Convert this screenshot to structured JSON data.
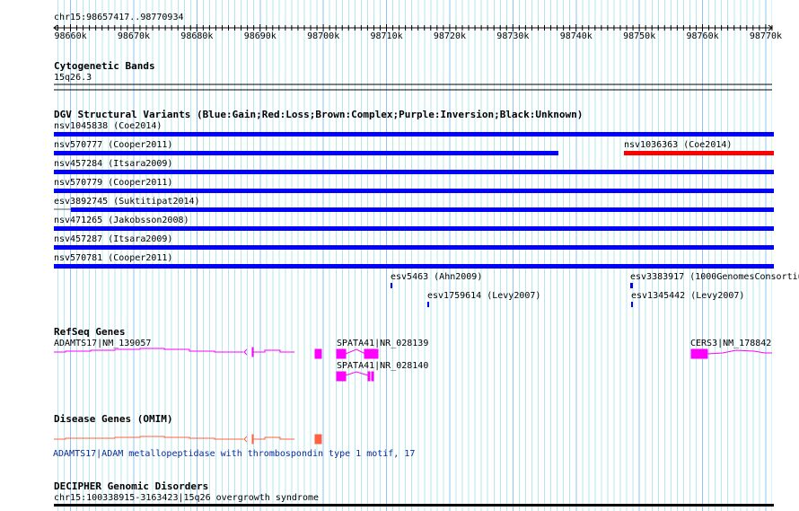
{
  "ruler": {
    "position": "chr15:98657417..98770934",
    "ticks": [
      "98660k",
      "98670k",
      "98680k",
      "98690k",
      "98700k",
      "98710k",
      "98720k",
      "98730k",
      "98740k",
      "98750k",
      "98760k",
      "98770k"
    ]
  },
  "cytoband": {
    "title": "Cytogenetic Bands",
    "band": "15q26.3"
  },
  "dgv": {
    "title": "DGV Structural Variants (Blue:Gain;Red:Loss;Brown:Complex;Purple:Inversion;Black:Unknown)",
    "variants": [
      {
        "label": "nsv1045838 (Coe2014)",
        "color": "#0000ff"
      },
      {
        "label": "nsv570777 (Cooper2011)",
        "color": "#0000ff"
      },
      {
        "label": "nsv1036363 (Coe2014)",
        "color": "#ff0000"
      },
      {
        "label": "nsv457284 (Itsara2009)",
        "color": "#0000ff"
      },
      {
        "label": "nsv570779 (Cooper2011)",
        "color": "#0000ff"
      },
      {
        "label": "esv3892745 (Suktitipat2014)",
        "color": "#0000ff"
      },
      {
        "label": "nsv471265 (Jakobsson2008)",
        "color": "#0000ff"
      },
      {
        "label": "nsv457287 (Itsara2009)",
        "color": "#0000ff"
      },
      {
        "label": "nsv570781 (Cooper2011)",
        "color": "#0000ff"
      },
      {
        "label": "esv5463 (Ahn2009)",
        "color": "#0000ff"
      },
      {
        "label": "esv1759614 (Levy2007)",
        "color": "#0000ff"
      },
      {
        "label": "esv3383917 (1000GenomesConsortiu",
        "color": "#0000ff"
      },
      {
        "label": "esv1345442 (Levy2007)",
        "color": "#0000ff"
      }
    ]
  },
  "refseq": {
    "title": "RefSeq Genes",
    "genes": [
      "ADAMTS17|NM_139057",
      "SPATA41|NR_028139",
      "SPATA41|NR_028140",
      "CERS3|NM_178842"
    ],
    "color": "#ff00ff"
  },
  "omim": {
    "title": "Disease Genes (OMIM)",
    "label": "ADAMTS17|ADAM metallopeptidase with thrombospondin type 1 motif, 17",
    "color": "#ff6040"
  },
  "decipher": {
    "title": "DECIPHER Genomic Disorders",
    "label": "chr15:100338915-3163423|15q26 overgrowth syndrome"
  }
}
